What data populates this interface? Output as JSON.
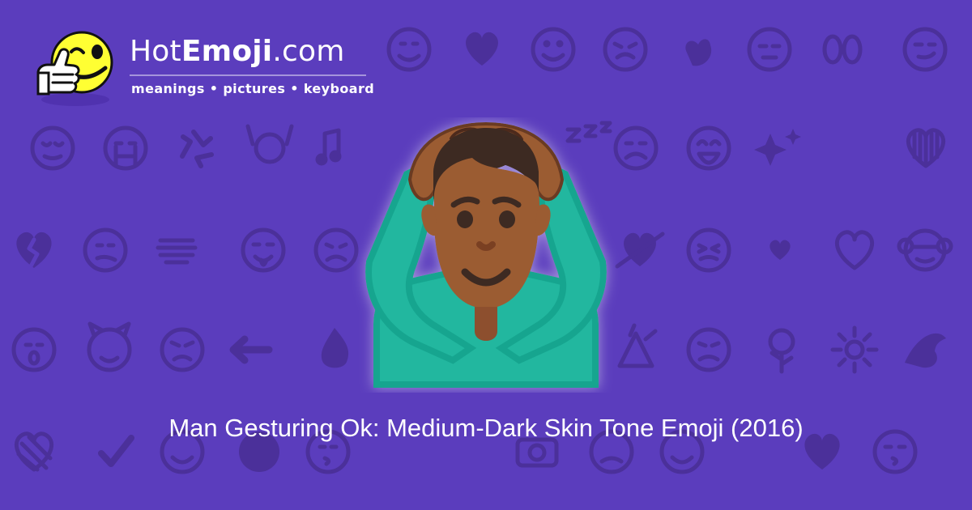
{
  "header": {
    "brand_prefix": "Hot",
    "brand_emphasis": "Emoji",
    "brand_suffix": ".com",
    "tagline": "meanings • pictures • keyboard"
  },
  "hero": {
    "emoji_name": "man-gesturing-ok-medium-dark-skin-tone",
    "title": "Man Gesturing Ok: Medium-Dark Skin Tone Emoji (2016)"
  },
  "style": {
    "background": "#5b3dbd",
    "pattern": "#4b309a",
    "skin_tone": "#9b5b33",
    "shirt": "#21b79f",
    "hair": "#3e2a20",
    "text": "#ffffff"
  },
  "background_icons": [
    "grinning-face-icon",
    "winking-face-icon",
    "kissing-face-icon",
    "heart-icon",
    "smiling-face-icon",
    "persevering-face-icon",
    "ok-hand-icon",
    "sleeping-face-icon",
    "eyes-icon",
    "smirking-face-icon",
    "relieved-face-icon",
    "crying-face-icon",
    "recycle-icon",
    "raised-hands-icon",
    "music-notes-icon",
    "sleeping-zzz-icon",
    "sad-face-icon",
    "laughing-face-icon",
    "sparkles-icon",
    "striped-heart-icon",
    "broken-heart-icon",
    "confused-face-icon",
    "tongue-face-icon",
    "frowning-face-icon",
    "heart-arrow-icon",
    "confounded-face-icon",
    "revolving-hearts-icon",
    "see-no-evil-monkey-icon",
    "shocked-face-icon",
    "devil-face-icon",
    "angry-face-icon",
    "left-arrow-icon",
    "fire-icon",
    "party-popper-icon",
    "rose-icon",
    "sun-icon",
    "flexed-biceps-icon",
    "check-mark-icon",
    "camera-icon",
    "heart-eyes-icon",
    "waving-hand-icon"
  ]
}
